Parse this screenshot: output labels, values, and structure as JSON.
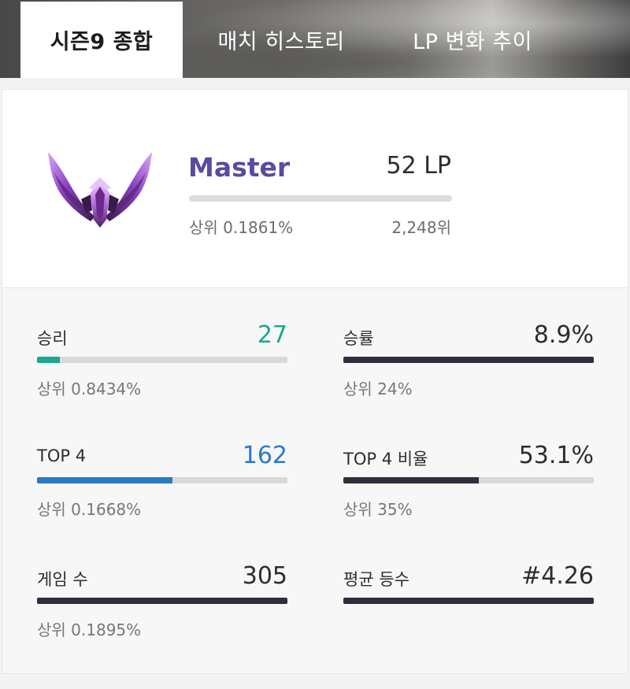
{
  "tabs": [
    {
      "label": "시즌9 종합",
      "active": true
    },
    {
      "label": "매치 히스토리",
      "active": false
    },
    {
      "label": "LP 변화 추이",
      "active": false
    }
  ],
  "rank": {
    "emblem": "master-tier-emblem",
    "tier": "Master",
    "lp": "52 LP",
    "lp_progress": 0,
    "percentile": "상위 0.1861%",
    "position": "2,248위",
    "tier_color": "#5a4aa0"
  },
  "stats": [
    {
      "id": "wins",
      "label": "승리",
      "value": "27",
      "value_color": "#1aa98f",
      "bar_fill": 0.09,
      "bar_color": "#1aa98f",
      "sub": "상위 0.8434%"
    },
    {
      "id": "winrate",
      "label": "승률",
      "value": "8.9%",
      "value_color": "#2c2c31",
      "bar_fill": 1.0,
      "bar_color": "#2e2f3b",
      "sub": "상위 24%"
    },
    {
      "id": "top4",
      "label": "TOP 4",
      "value": "162",
      "value_color": "#2a7ac4",
      "bar_fill": 0.54,
      "bar_color": "#2a7ac4",
      "sub": "상위 0.1668%"
    },
    {
      "id": "top4rate",
      "label": "TOP 4 비율",
      "value": "53.1%",
      "value_color": "#2c2c31",
      "bar_fill": 0.54,
      "bar_color": "#2e2f3b",
      "sub": "상위 35%"
    },
    {
      "id": "games",
      "label": "게임 수",
      "value": "305",
      "value_color": "#2c2c31",
      "bar_fill": 1.0,
      "bar_color": "#2e2f3b",
      "sub": "상위 0.1895%"
    },
    {
      "id": "avgplace",
      "label": "평균 등수",
      "value": "#4.26",
      "value_color": "#2c2c31",
      "bar_fill": 1.0,
      "bar_color": "#2e2f3b",
      "sub": ""
    }
  ]
}
